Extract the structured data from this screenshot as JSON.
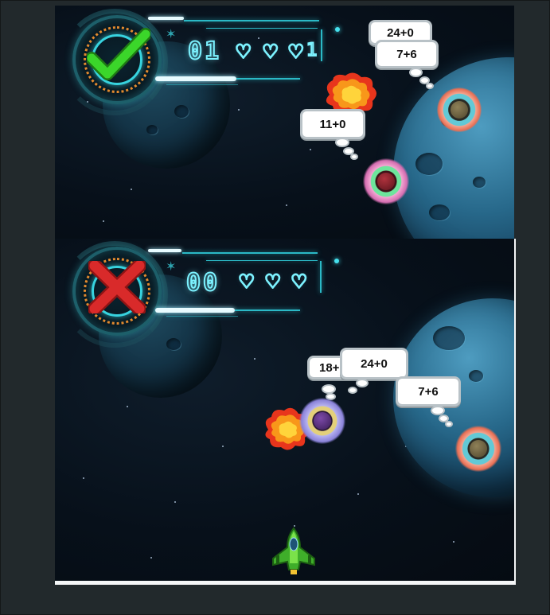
{
  "top_panel": {
    "result_icon": "checkmark-icon",
    "score": "01",
    "lives": [
      "heart-icon",
      "heart-icon",
      "heart-icon"
    ],
    "lives_suffix": "1",
    "bubbles": [
      {
        "text": "24+0"
      },
      {
        "text": "7+6"
      },
      {
        "text": "11+0"
      }
    ]
  },
  "bottom_panel": {
    "result_icon": "cross-icon",
    "score": "00",
    "lives": [
      "heart-icon",
      "heart-icon",
      "heart-icon"
    ],
    "bubbles": [
      {
        "text": "18+"
      },
      {
        "text": "24+0"
      },
      {
        "text": "7+6"
      }
    ]
  },
  "colors": {
    "hud_cyan": "#7cf2ff",
    "check_green": "#3bd62a",
    "cross_red": "#d92a2a",
    "space_bg": "#07101a",
    "planet_blue": "#27688a"
  }
}
